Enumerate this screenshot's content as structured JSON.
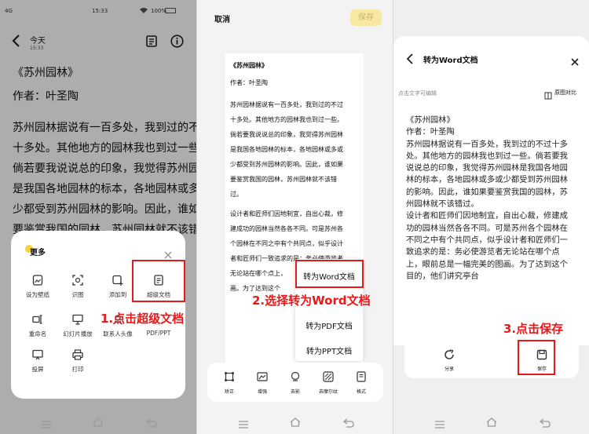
{
  "panel1": {
    "status": {
      "left": "4G",
      "time": "15:33",
      "battery": "100%"
    },
    "header": {
      "title": "今天",
      "subtitle": "15:33"
    },
    "article": {
      "title": "《苏州园林》",
      "author": "作者：叶圣陶",
      "lines": [
        "苏州园林据说有一百多处，我到过的不过",
        "十多处。其他地方的园林我也到过一些。",
        "倘若要我说说总的印象，我觉得苏州园林",
        "是我国各地园林的标本，各地园林或多或",
        "少都受到苏州园林的影响。因此，谁如果",
        "要鉴赏我国的园林，苏州园林就不该错"
      ]
    },
    "sheet": {
      "title": "更多",
      "items": [
        {
          "label": "设为壁纸",
          "icon": "wallpaper-icon"
        },
        {
          "label": "识图",
          "icon": "scan-image-icon"
        },
        {
          "label": "添加到",
          "icon": "add-to-icon"
        },
        {
          "label": "超级文档",
          "icon": "super-document-icon"
        },
        {
          "label": "重命名",
          "icon": "rename-icon"
        },
        {
          "label": "幻灯片播放",
          "icon": "slideshow-icon"
        },
        {
          "label": "联系人头像",
          "icon": "contact-avatar-icon"
        },
        {
          "label": "PDF/PPT",
          "icon": "pdf-ppt-icon"
        },
        {
          "label": "投屏",
          "icon": "cast-screen-icon"
        },
        {
          "label": "打印",
          "icon": "print-icon"
        }
      ]
    },
    "step_label": "1.点击超级文档"
  },
  "panel2": {
    "cancel_label": "取消",
    "save_label": "保存",
    "doc": {
      "title": "《苏州园林》",
      "author": "作者：叶圣陶",
      "para1": [
        "苏州园林据说有一百多处，我到过的不过",
        "十多处。其他地方的园林我也到过一些。",
        "倘若要我说说总的印象，我觉得苏州园林",
        "是我国各地园林的标本，各地园林或多或",
        "少都受到苏州园林的影响。因此，谁如果",
        "要鉴赏我国的园林，苏州园林就不该错",
        "过。"
      ],
      "para2": [
        "设计者和匠师们因地制宜，自出心裁，修",
        "建成功的园林当然各各不同。可是苏州各",
        "个园林在不同之中有个共同点，似乎设计",
        "者和匠师们一致追求的是：务必使游览者",
        "无论站在哪个点上，",
        "画。为了达到这个"
      ]
    },
    "menu": {
      "word": "转为Word文档",
      "pdf": "转为PDF文档",
      "ppt": "转为PPT文档"
    },
    "toolbar": [
      {
        "label": "矫正",
        "icon": "correct-icon"
      },
      {
        "label": "增强",
        "icon": "enhance-icon"
      },
      {
        "label": "去影",
        "icon": "remove-shadow-icon"
      },
      {
        "label": "去摩尔纹",
        "icon": "remove-moire-icon"
      },
      {
        "label": "格式",
        "icon": "format-icon"
      }
    ],
    "step_label": "2.选择转为Word文档"
  },
  "panel3": {
    "title": "转为Word文档",
    "hint": "点击文字可编辑",
    "compare_label": "原图对比",
    "lines": [
      "《苏州园林》",
      "作者：叶圣陶",
      "苏州园林据说有一百多处，我到过的不过十多",
      "处。其他地方的园林我也到过一些。倘若要我",
      "说说总的印象，我觉得苏州园林是我国各地园",
      "林的标本，各地园林或多或少都受到苏州园林",
      "的影响。因此，谁如果要鉴赏我国的园林，苏",
      "州园林就不该错过。",
      "设计者和匠师们因地制宜，自出心裁，修建成",
      "功的园林当然各各不同。可是苏州各个园林在",
      "不同之中有个共同点，似乎设计者和匠师们一",
      "致追求的是：务必使游览者无论站在哪个点",
      "上，眼前总是一幅完美的图画。为了达到这个",
      "目的，他们讲究亭台"
    ],
    "share_label": "分享",
    "save_label": "保存",
    "step_label": "3.点击保存"
  }
}
